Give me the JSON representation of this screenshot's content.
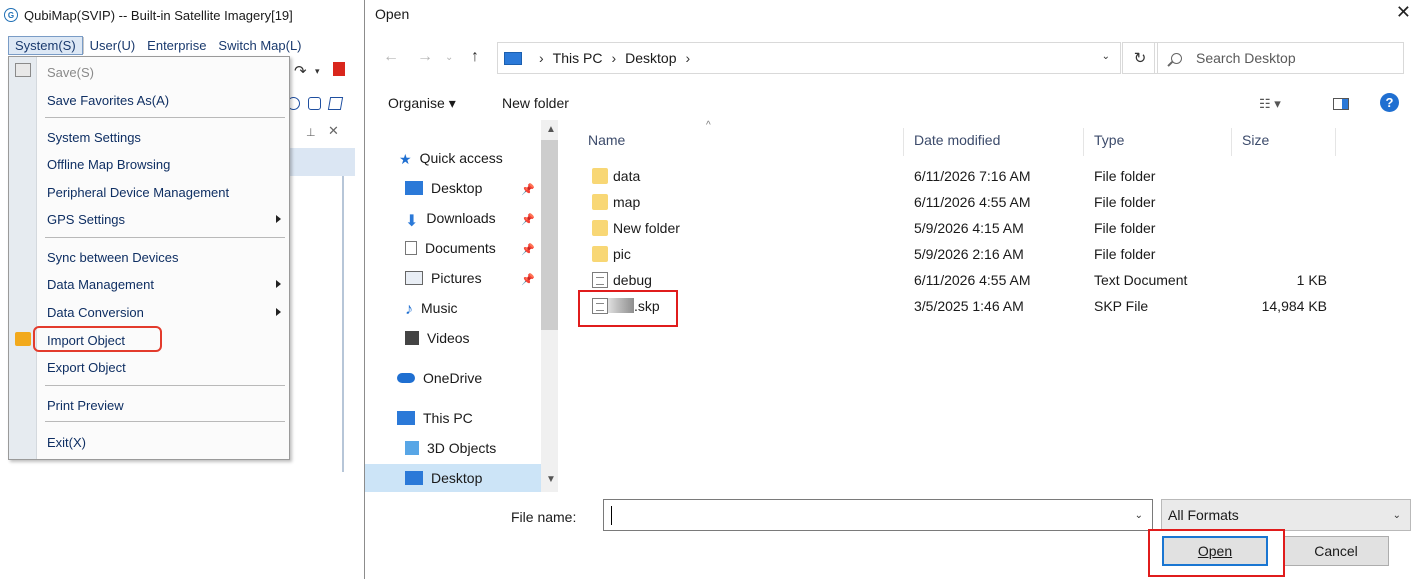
{
  "app": {
    "title": "QubiMap(SVIP) -- Built-in Satellite Imagery[19]",
    "menubar": [
      "System(S)",
      "User(U)",
      "Enterprise",
      "Switch Map(L)"
    ],
    "system_menu": {
      "items": [
        {
          "label": "Save(S)",
          "disabled": true
        },
        {
          "label": "Save Favorites As(A)"
        },
        {
          "label": "System Settings"
        },
        {
          "label": "Offline Map Browsing"
        },
        {
          "label": "Peripheral Device Management"
        },
        {
          "label": "GPS Settings",
          "submenu": true
        },
        {
          "label": "Sync between Devices"
        },
        {
          "label": "Data Management",
          "submenu": true
        },
        {
          "label": "Data Conversion",
          "submenu": true
        },
        {
          "label": "Import Object",
          "highlighted": true
        },
        {
          "label": "Export Object"
        },
        {
          "label": "Print Preview"
        },
        {
          "label": "Exit(X)"
        }
      ]
    }
  },
  "dialog": {
    "title": "Open",
    "close": "✕",
    "address": {
      "root": "This PC",
      "folder": "Desktop"
    },
    "search_placeholder": "Search Desktop",
    "toolbar": {
      "organise": "Organise ▾",
      "new_folder": "New folder"
    },
    "nav": [
      {
        "label": "Quick access",
        "icon": "star-icon"
      },
      {
        "label": "Desktop",
        "icon": "desktop-icon",
        "pinned": true
      },
      {
        "label": "Downloads",
        "icon": "download-icon",
        "pinned": true
      },
      {
        "label": "Documents",
        "icon": "documents-icon",
        "pinned": true
      },
      {
        "label": "Pictures",
        "icon": "pictures-icon",
        "pinned": true
      },
      {
        "label": "Music",
        "icon": "music-icon"
      },
      {
        "label": "Videos",
        "icon": "videos-icon"
      },
      {
        "label": "OneDrive",
        "icon": "cloud-icon"
      },
      {
        "label": "This PC",
        "icon": "pc-icon"
      },
      {
        "label": "3D Objects",
        "icon": "cube-icon"
      },
      {
        "label": "Desktop",
        "icon": "desktop-icon",
        "selected": true
      }
    ],
    "columns": [
      "Name",
      "Date modified",
      "Type",
      "Size"
    ],
    "files": [
      {
        "name": "data",
        "date": "6/11/2026 7:16 AM",
        "type": "File folder",
        "size": "",
        "kind": "folder"
      },
      {
        "name": "map",
        "date": "6/11/2026 4:55 AM",
        "type": "File folder",
        "size": "",
        "kind": "folder"
      },
      {
        "name": "New folder",
        "date": "5/9/2026 4:15 AM",
        "type": "File folder",
        "size": "",
        "kind": "folder"
      },
      {
        "name": "pic",
        "date": "5/9/2026 2:16 AM",
        "type": "File folder",
        "size": "",
        "kind": "folder"
      },
      {
        "name": "debug",
        "date": "6/11/2026 4:55 AM",
        "type": "Text Document",
        "size": "1 KB",
        "kind": "doc"
      },
      {
        "name": ".skp",
        "date": "3/5/2025 1:46 AM",
        "type": "SKP File",
        "size": "14,984 KB",
        "kind": "doc",
        "redacted": true
      }
    ],
    "file_name_label": "File name:",
    "file_name_value": "",
    "filter": "All Formats",
    "open_label": "Open",
    "cancel_label": "Cancel"
  },
  "colors": {
    "highlight_red": "#e01c1c",
    "accent_blue": "#1a76d2",
    "selection": "#cce4f7"
  }
}
